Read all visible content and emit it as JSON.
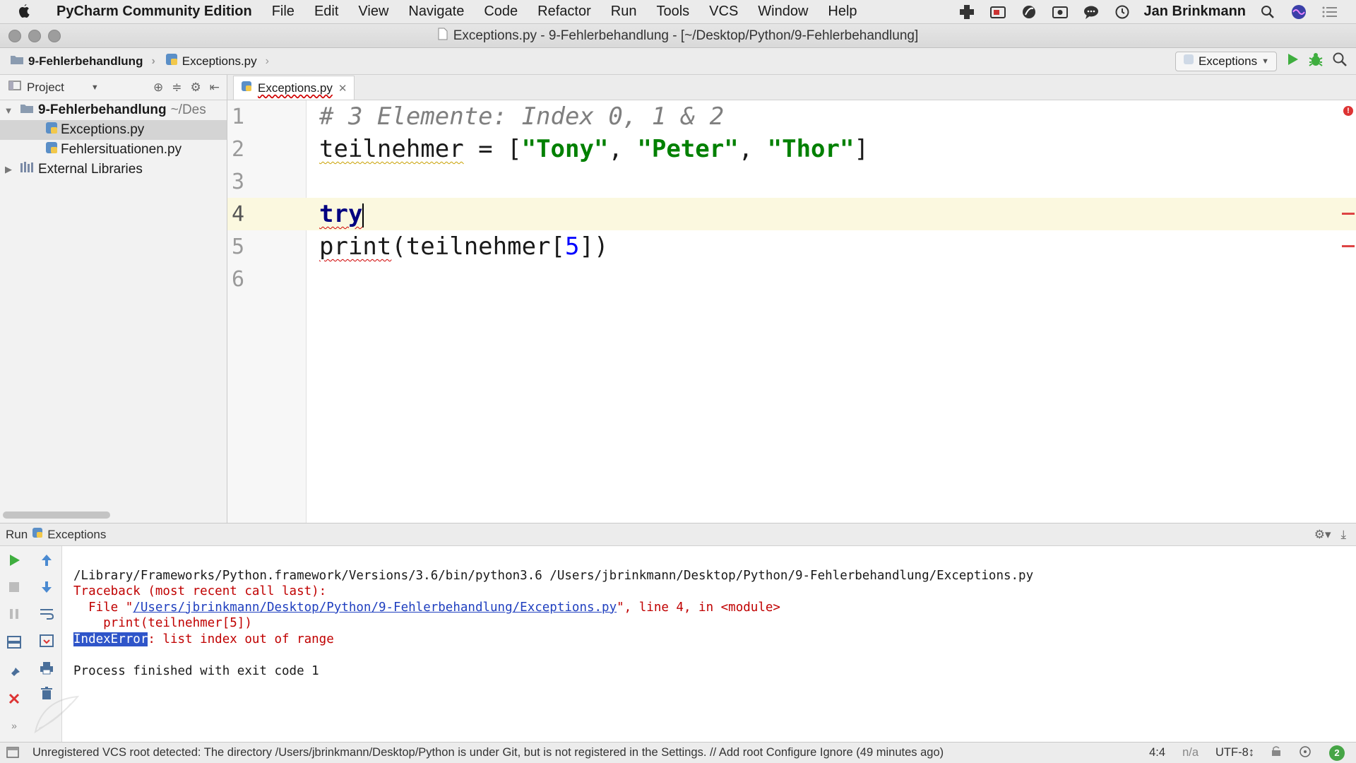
{
  "menubar": {
    "app_name": "PyCharm Community Edition",
    "items": [
      "File",
      "Edit",
      "View",
      "Navigate",
      "Code",
      "Refactor",
      "Run",
      "Tools",
      "VCS",
      "Window",
      "Help"
    ],
    "user": "Jan Brinkmann"
  },
  "window": {
    "title": "Exceptions.py - 9-Fehlerbehandlung - [~/Desktop/Python/9-Fehlerbehandlung]"
  },
  "navbar": {
    "breadcrumb_folder": "9-Fehlerbehandlung",
    "breadcrumb_file": "Exceptions.py",
    "run_config": "Exceptions"
  },
  "project": {
    "header": "Project",
    "root": "9-Fehlerbehandlung",
    "root_path": "~/Des",
    "files": [
      "Exceptions.py",
      "Fehlersituationen.py"
    ],
    "external": "External Libraries"
  },
  "editor": {
    "tab": "Exceptions.py",
    "line_numbers": [
      "1",
      "2",
      "3",
      "4",
      "5",
      "6"
    ],
    "line1": "# 3 Elemente: Index 0, 1 & 2",
    "line2_var": "teilnehmer",
    "line2_eq": " = [",
    "line2_s1": "\"Tony\"",
    "line2_s2": "\"Peter\"",
    "line2_s3": "\"Thor\"",
    "line2_sep": ", ",
    "line2_end": "]",
    "line4": "try",
    "line5_fn": "print",
    "line5_open": "(teilnehmer[",
    "line5_num": "5",
    "line5_close": "])"
  },
  "run": {
    "label": "Run",
    "config": "Exceptions",
    "cmd": "/Library/Frameworks/Python.framework/Versions/3.6/bin/python3.6 /Users/jbrinkmann/Desktop/Python/9-Fehlerbehandlung/Exceptions.py",
    "traceback": "Traceback (most recent call last):",
    "file_prefix": "  File \"",
    "file_link": "/Users/jbrinkmann/Desktop/Python/9-Fehlerbehandlung/Exceptions.py",
    "file_suffix": "\", line 4, in <module>",
    "code_line": "    print(teilnehmer[5])",
    "error_name": "IndexError",
    "error_msg": ": list index out of range",
    "finished": "Process finished with exit code 1"
  },
  "status": {
    "message": "Unregistered VCS root detected: The directory /Users/jbrinkmann/Desktop/Python is under Git, but is not registered in the Settings. // Add root  Configure  Ignore (49 minutes ago)",
    "position": "4:4",
    "na": "n/a",
    "encoding": "UTF-8↕",
    "badge": "2"
  }
}
